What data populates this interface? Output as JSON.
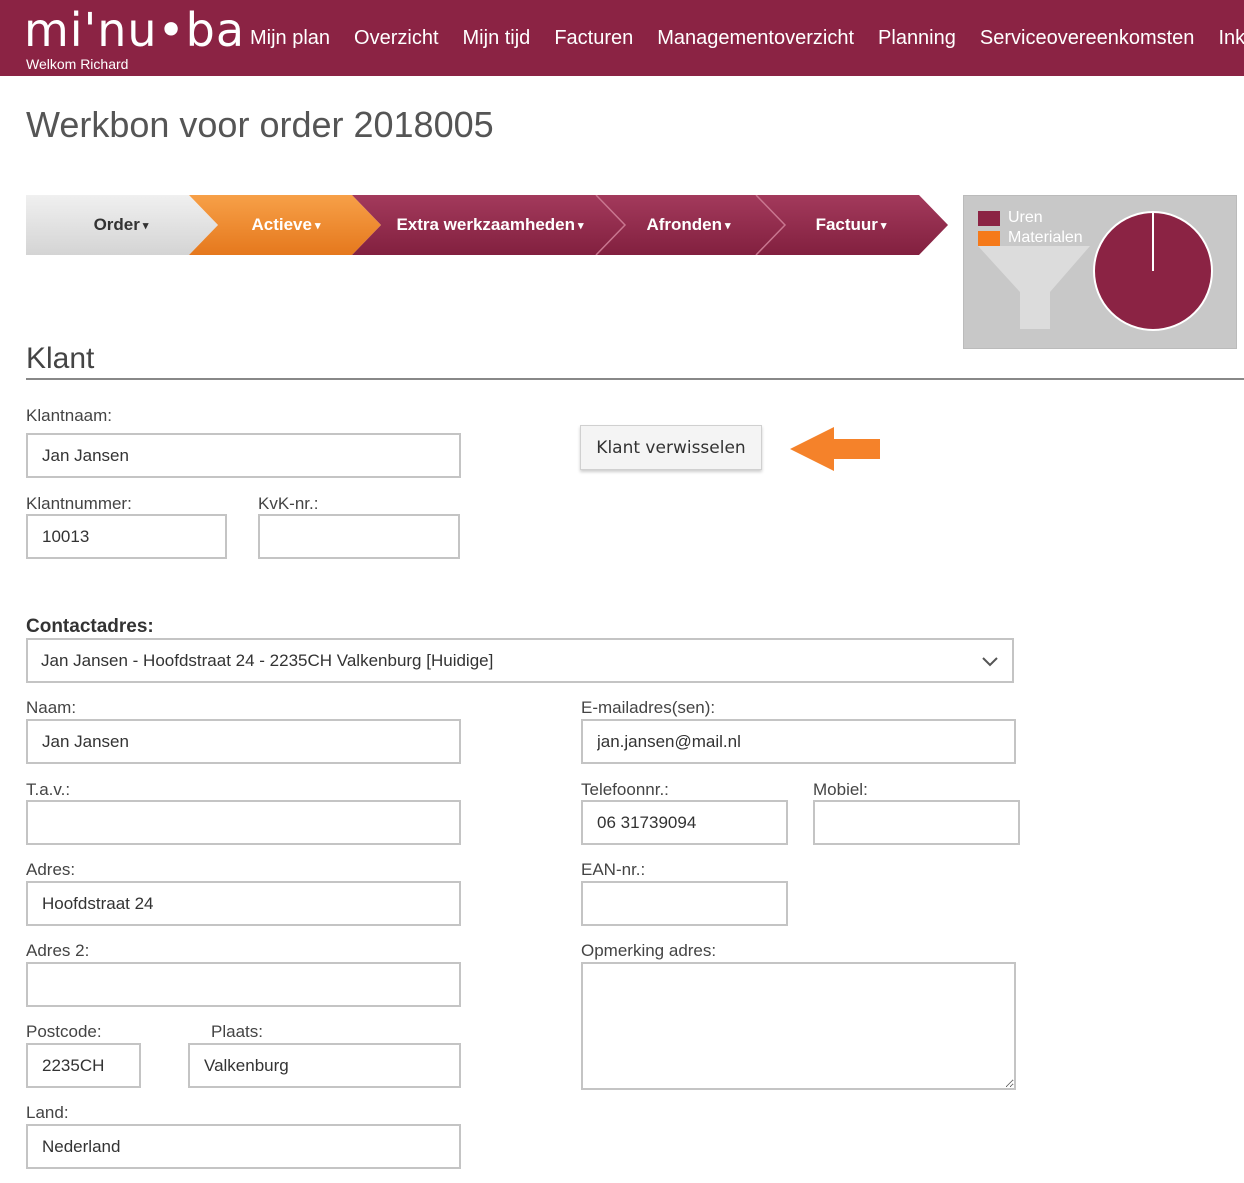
{
  "header": {
    "logo_text": "mi'nu•ba",
    "welcome": "Welkom Richard",
    "nav": [
      "Mijn plan",
      "Overzicht",
      "Mijn tijd",
      "Facturen",
      "Managementoverzicht",
      "Planning",
      "Serviceovereenkomsten",
      "Inkoo"
    ]
  },
  "page_title": "Werkbon voor order 2018005",
  "steps": [
    {
      "label": "Order",
      "caret": "▾",
      "state": "done"
    },
    {
      "label": "Actieve",
      "caret": "▾",
      "state": "active"
    },
    {
      "label": "Extra werkzaamheden",
      "caret": "▾",
      "state": "todo"
    },
    {
      "label": "Afronden",
      "caret": "▾",
      "state": "todo"
    },
    {
      "label": "Factuur",
      "caret": "▾",
      "state": "todo"
    }
  ],
  "colors": {
    "brand": "#8b2344",
    "active": "#f08a2c",
    "done": "#e2e2e2",
    "arrow": "#f5822a"
  },
  "mini_chart": {
    "legend": [
      {
        "name": "Uren",
        "color": "#8b2344"
      },
      {
        "name": "Materialen",
        "color": "#f57a1a"
      }
    ],
    "funnel_icon": "funnel-icon"
  },
  "chart_data": {
    "type": "pie",
    "categories": [
      "Uren",
      "Materialen"
    ],
    "values": [
      100,
      0
    ],
    "colors": [
      "#8b2344",
      "#f57a1a"
    ],
    "title": ""
  },
  "section_title": "Klant",
  "customer": {
    "klantnaam_label": "Klantnaam:",
    "klantnaam": "Jan Jansen",
    "switch_button": "Klant verwisselen",
    "klantnummer_label": "Klantnummer:",
    "klantnummer": "10013",
    "kvk_label": "KvK-nr.:",
    "kvk": ""
  },
  "contact": {
    "label": "Contactadres:",
    "selected": "Jan Jansen - Hoofdstraat 24 - 2235CH Valkenburg [Huidige]",
    "naam_label": "Naam:",
    "naam": "Jan Jansen",
    "tav_label": "T.a.v.:",
    "tav": "",
    "adres_label": "Adres:",
    "adres": "Hoofdstraat 24",
    "adres2_label": "Adres 2:",
    "adres2": "",
    "postcode_label": "Postcode:",
    "postcode": "2235CH",
    "plaats_label": "Plaats:",
    "plaats": "Valkenburg",
    "land_label": "Land:",
    "land": "Nederland",
    "email_label": "E-mailadres(sen):",
    "email": "jan.jansen@mail.nl",
    "telefoon_label": "Telefoonnr.:",
    "telefoon": "06 31739094",
    "mobiel_label": "Mobiel:",
    "mobiel": "",
    "ean_label": "EAN-nr.:",
    "ean": "",
    "opmerking_label": "Opmerking adres:",
    "opmerking": ""
  }
}
